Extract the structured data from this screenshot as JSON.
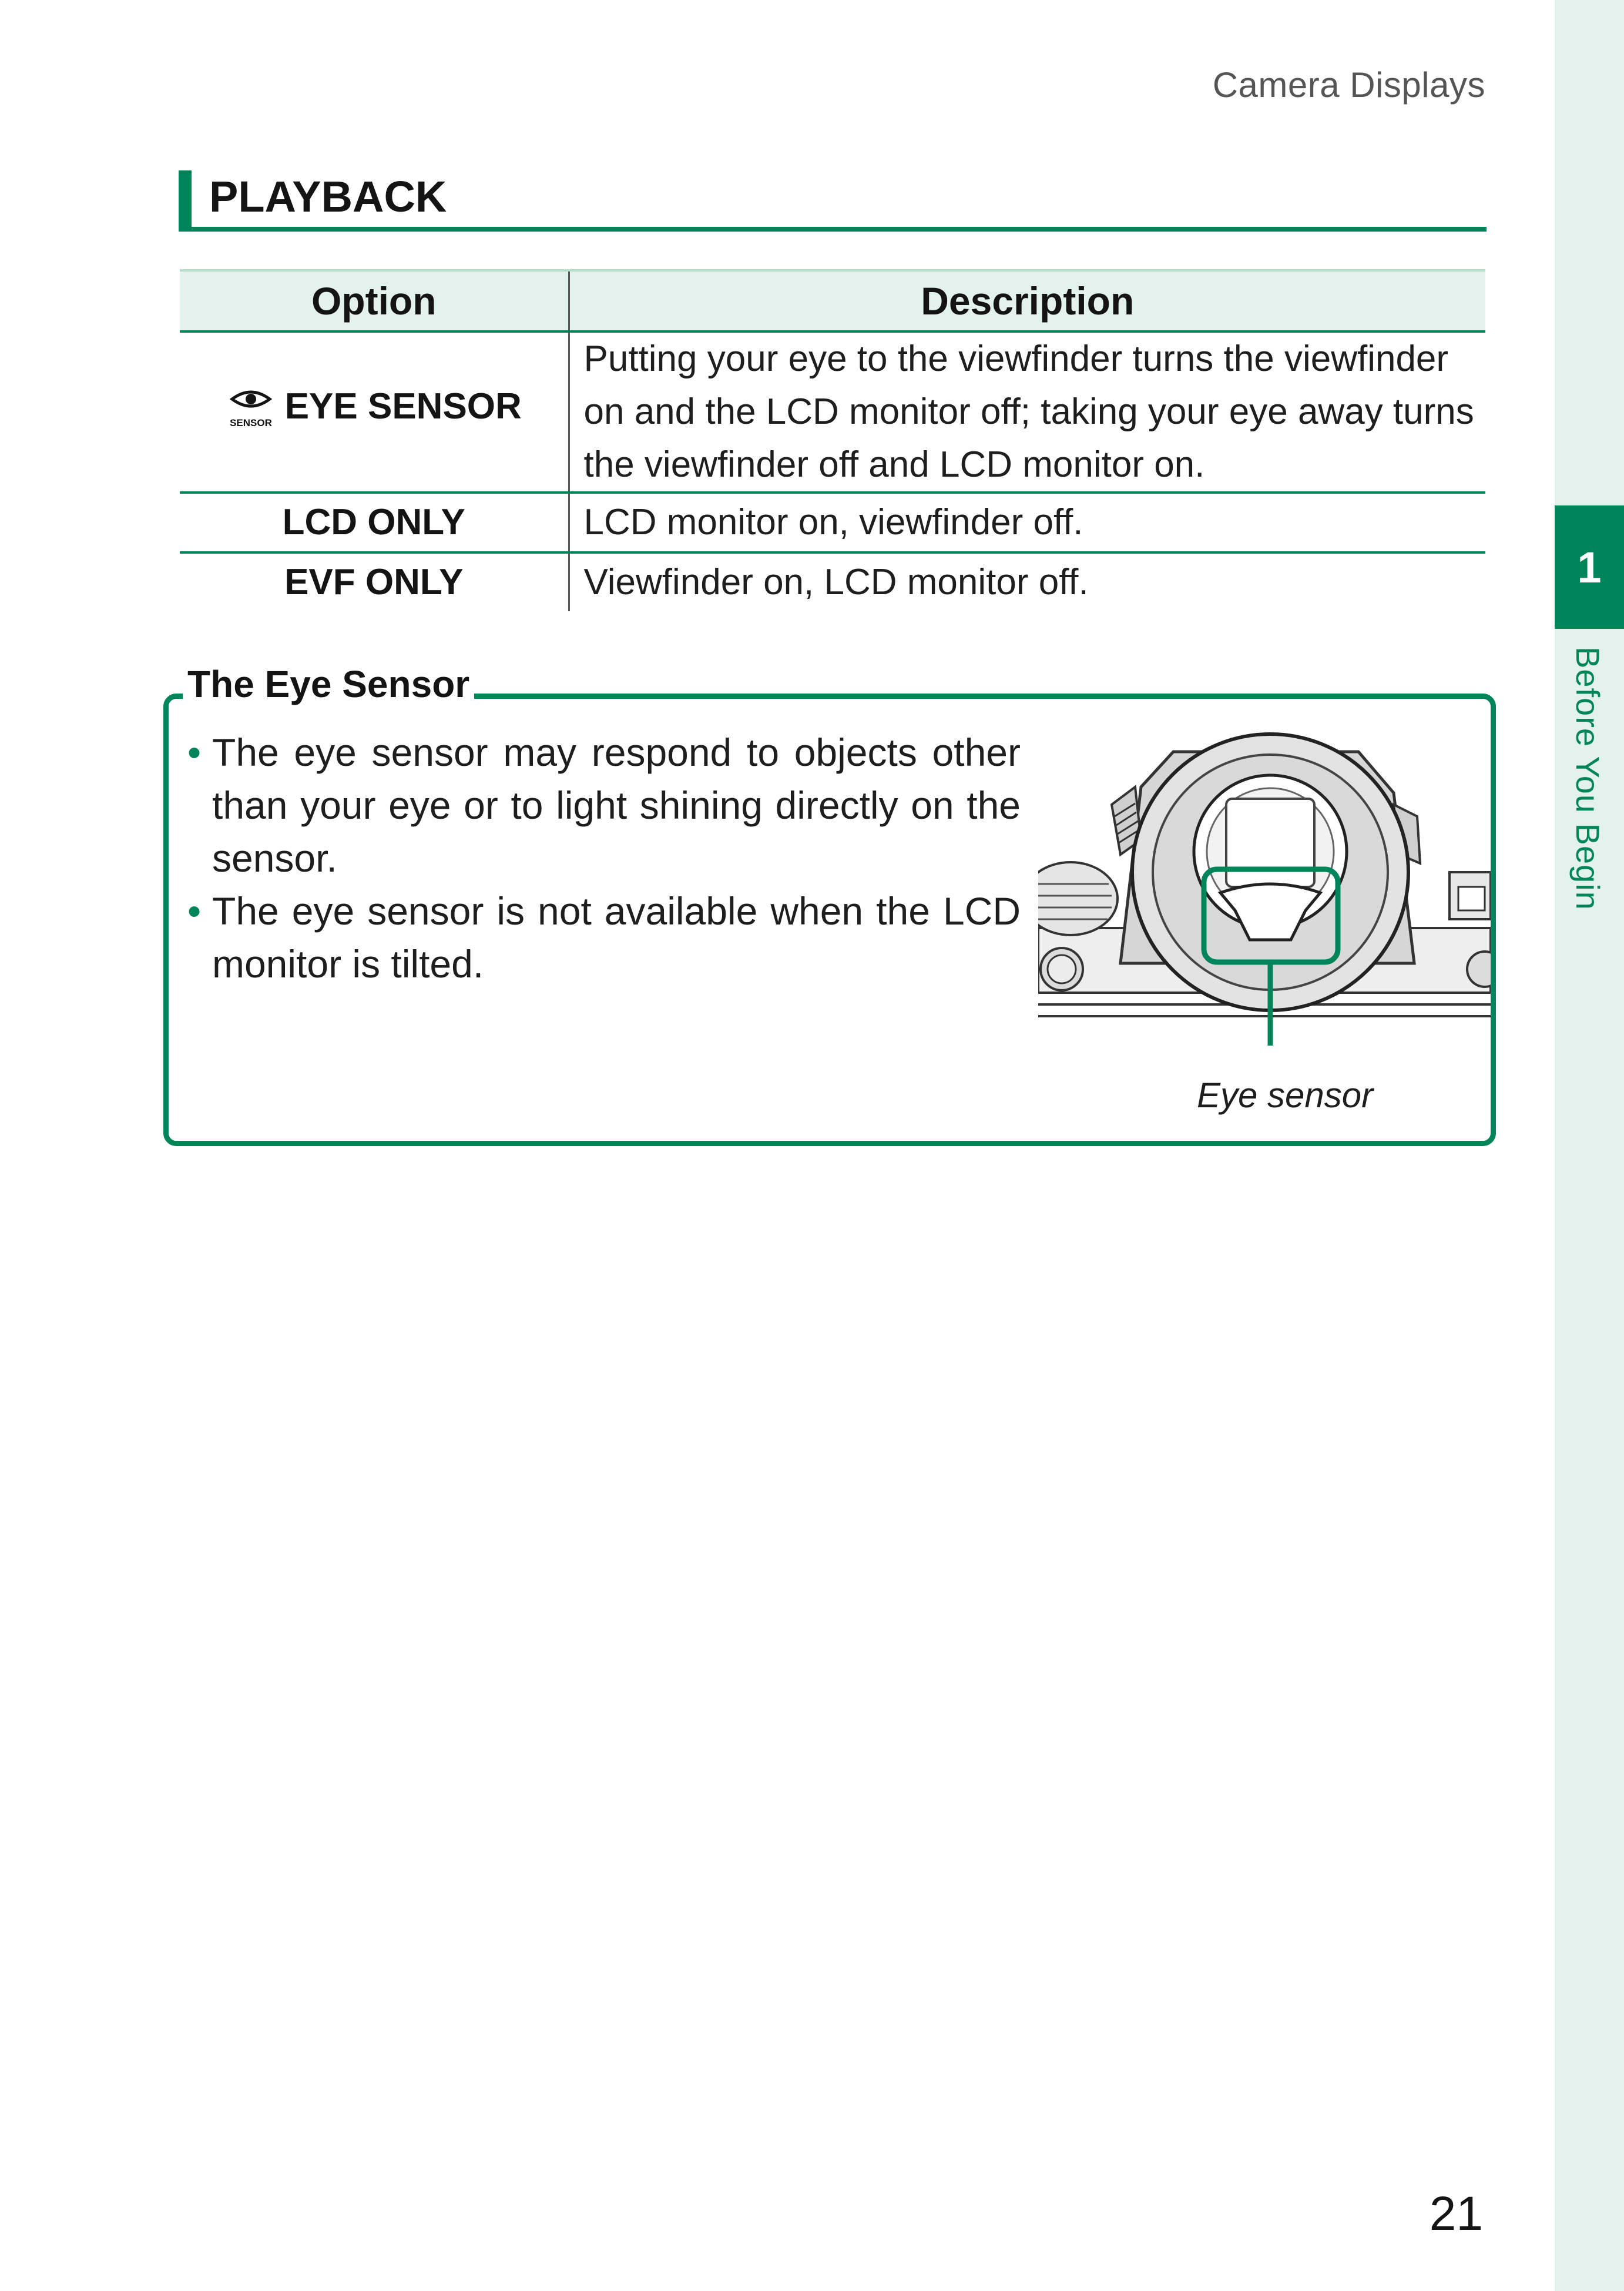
{
  "header": {
    "title": "Camera Displays"
  },
  "section": {
    "heading": "PLAYBACK"
  },
  "table": {
    "headers": {
      "option": "Option",
      "description": "Description"
    },
    "rows": [
      {
        "icon": "eye-sensor-icon",
        "icon_label": "SENSOR",
        "option": "EYE SENSOR",
        "description_lines": [
          "Putting your eye to the viewfinder turns the viewfinder",
          "on and the LCD monitor off; taking your eye away turns",
          "the viewfinder off and LCD monitor on."
        ]
      },
      {
        "option": "LCD ONLY",
        "description_lines": [
          "LCD monitor on, viewfinder off."
        ]
      },
      {
        "option": "EVF ONLY",
        "description_lines": [
          "Viewfinder on, LCD monitor off."
        ]
      }
    ]
  },
  "note": {
    "title": "The Eye Sensor",
    "items": [
      "The eye sensor may respond to objects other than your eye or to light shining directly on the sensor.",
      "The eye sensor is not available when the LCD monitor is tilted."
    ],
    "figure_caption": "Eye sensor"
  },
  "sidebar": {
    "chapter_number": "1",
    "chapter_title": "Before You Begin"
  },
  "footer": {
    "page_number": "21"
  },
  "colors": {
    "accent": "#00845a",
    "tint": "#e3f2ec"
  }
}
